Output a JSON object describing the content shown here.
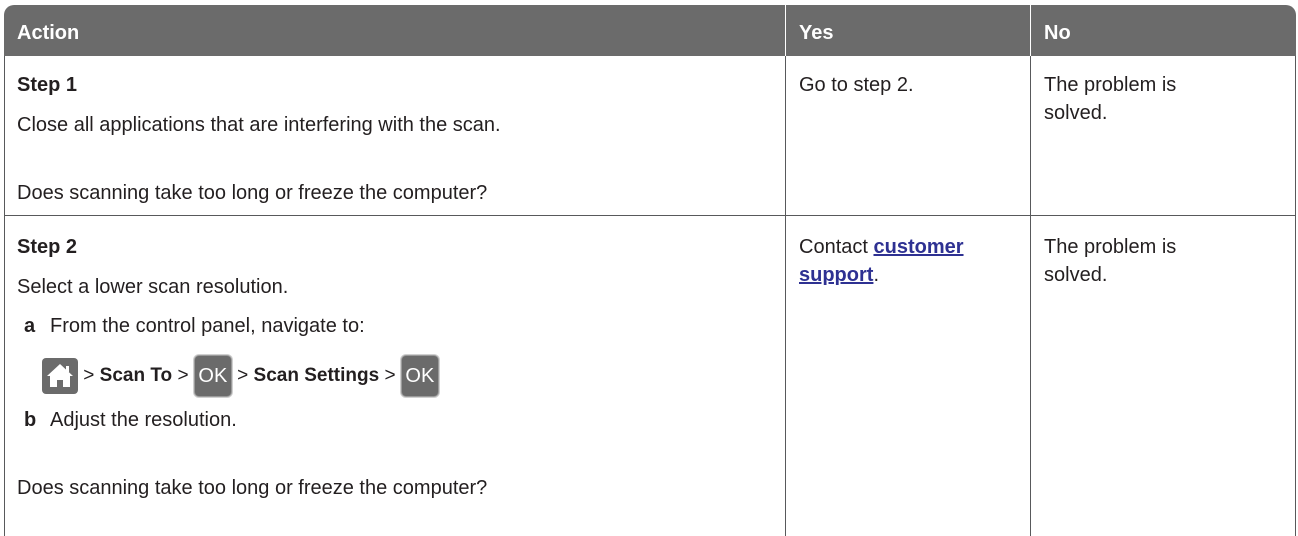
{
  "header": {
    "action": "Action",
    "yes": "Yes",
    "no": "No"
  },
  "rows": [
    {
      "step_title": "Step 1",
      "text": "Close all applications that are interfering with the scan.",
      "question": "Does scanning take too long or freeze the computer?",
      "yes": "Go to step 2.",
      "no": "The problem is solved."
    },
    {
      "step_title": "Step 2",
      "text": "Select a lower scan resolution.",
      "sub_a_letter": "a",
      "sub_a": "From the control panel, navigate to:",
      "nav": {
        "sep": ">",
        "scan_to": "Scan To",
        "ok": "OK",
        "scan_settings": "Scan Settings"
      },
      "sub_b_letter": "b",
      "sub_b": "Adjust the resolution.",
      "question": "Does scanning take too long or freeze the computer?",
      "yes_prefix": "Contact ",
      "yes_link": "customer support",
      "yes_suffix": ".",
      "no": "The problem is solved."
    }
  ],
  "colors": {
    "header_bg": "#6b6b6b",
    "link": "#2e3192",
    "text": "#231f20"
  }
}
